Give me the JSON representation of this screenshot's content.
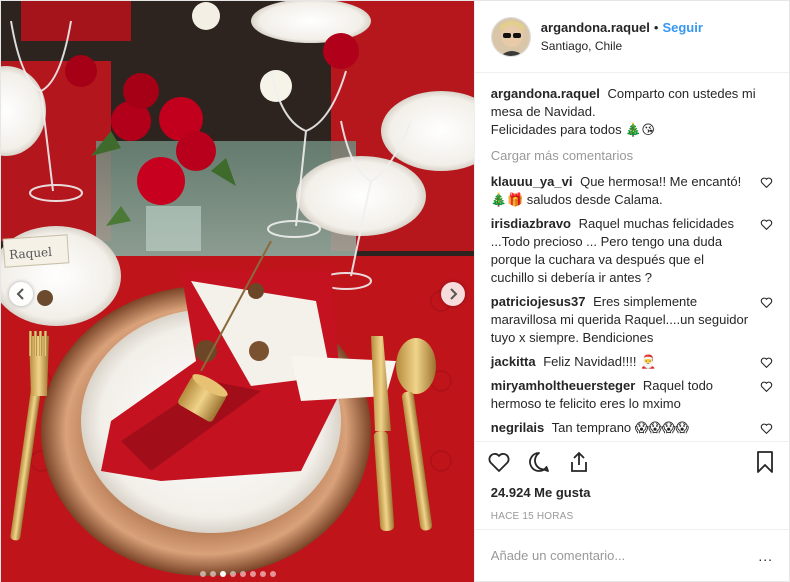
{
  "header": {
    "username": "argandona.raquel",
    "separator": "•",
    "follow_label": "Seguir",
    "location": "Santiago, Chile"
  },
  "caption": {
    "username": "argandona.raquel",
    "text": "Comparto con ustedes mi mesa de Navidad.",
    "text2": "Felicidades para todos",
    "emojis": "🎄😘"
  },
  "load_more_label": "Cargar más comentarios",
  "comments": [
    {
      "username": "klauuu_ya_vi",
      "text": "Que hermosa!! Me encantó! 🎄🎁 saludos desde Calama."
    },
    {
      "username": "irisdiazbravo",
      "text": "Raquel muchas felicidades ...Todo precioso ... Pero tengo una duda porque la cuchara va después que el cuchillo si debería ir antes ?"
    },
    {
      "username": "patriciojesus37",
      "text": "Eres simplemente maravillosa mi querida Raquel....un seguidor tuyo x siempre. Bendiciones"
    },
    {
      "username": "jackitta",
      "text": "Feliz Navidad!!!! 🎅"
    },
    {
      "username": "miryamholtheuersteger",
      "text": "Raquel todo hermoso te felicito eres lo mximo"
    },
    {
      "username": "negrilais",
      "text": "Tan temprano 😱😱😱😱"
    }
  ],
  "likes_text": "24.924 Me gusta",
  "time_text": "HACE 15 HORAS",
  "add_comment_placeholder": "Añade un comentario...",
  "more_label": "...",
  "photo": {
    "place_card_text": "Raquel"
  },
  "carousel": {
    "dot_count": 8,
    "active_index": 2
  },
  "colors": {
    "accent": "#3897f0",
    "muted": "#999999",
    "tablecloth": "#c0141b"
  },
  "icons": [
    "heart-icon",
    "comment-icon",
    "share-icon",
    "bookmark-icon",
    "chevron-left-icon",
    "chevron-right-icon"
  ]
}
